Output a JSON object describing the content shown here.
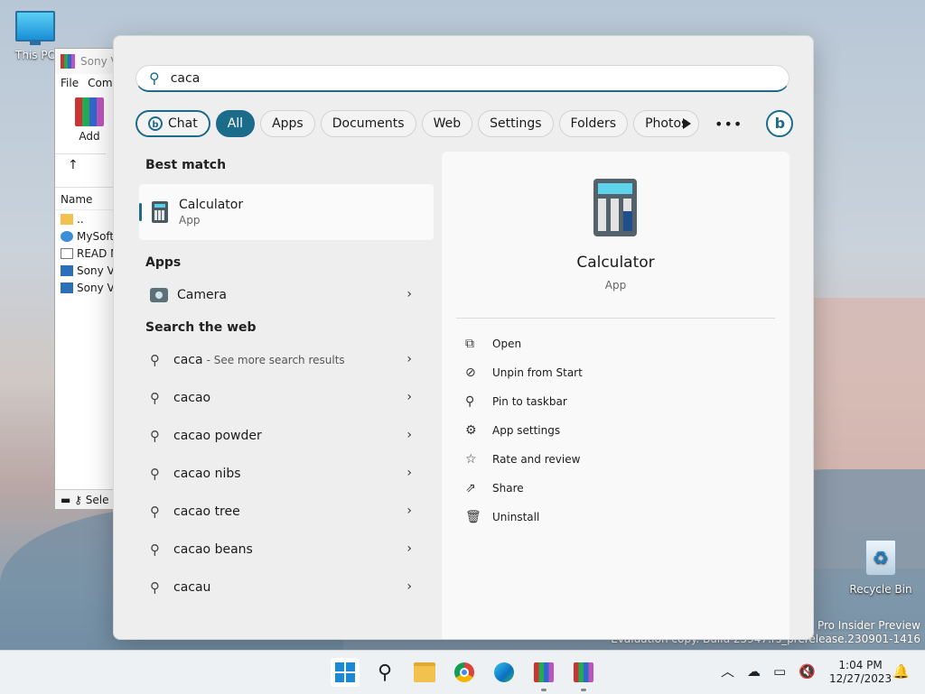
{
  "desktop": {
    "icons": [
      {
        "label": "This PC"
      },
      {
        "label": "Recycle Bin"
      }
    ],
    "watermark": {
      "line1": "11 Pro Insider Preview",
      "line2": "Evaluation copy. Build 25947.rs_prerelease.230901-1416"
    }
  },
  "bg_window": {
    "title": "Sony V",
    "menu": [
      "File",
      "Com"
    ],
    "toolbar_add": "Add",
    "column_name": "Name",
    "files": [
      "..",
      "MySoftw",
      "READ M",
      "Sony Ve",
      "Sony Ve"
    ],
    "status": "Sele"
  },
  "search": {
    "query": "caca",
    "filters": [
      "Chat",
      "All",
      "Apps",
      "Documents",
      "Web",
      "Settings",
      "Folders",
      "Photos"
    ],
    "best_match_title": "Best match",
    "best_match": {
      "name": "Calculator",
      "type": "App"
    },
    "apps_title": "Apps",
    "apps": [
      {
        "name": "Camera"
      }
    ],
    "web_title": "Search the web",
    "web_results": [
      {
        "text": "caca",
        "sub": "- See more search results"
      },
      {
        "text": "cacao",
        "sub": ""
      },
      {
        "text": "cacao powder",
        "sub": ""
      },
      {
        "text": "cacao nibs",
        "sub": ""
      },
      {
        "text": "cacao tree",
        "sub": ""
      },
      {
        "text": "cacao beans",
        "sub": ""
      },
      {
        "text": "cacau",
        "sub": ""
      }
    ],
    "detail": {
      "name": "Calculator",
      "type": "App",
      "actions": [
        {
          "label": "Open",
          "icon": "open-external-icon"
        },
        {
          "label": "Unpin from Start",
          "icon": "unpin-icon"
        },
        {
          "label": "Pin to taskbar",
          "icon": "pin-icon"
        },
        {
          "label": "App settings",
          "icon": "gear-icon"
        },
        {
          "label": "Rate and review",
          "icon": "star-icon"
        },
        {
          "label": "Share",
          "icon": "share-icon"
        },
        {
          "label": "Uninstall",
          "icon": "trash-icon"
        }
      ]
    }
  },
  "taskbar": {
    "time": "1:04 PM",
    "date": "12/27/2023"
  },
  "colors": {
    "accent": "#1b6b8a"
  }
}
